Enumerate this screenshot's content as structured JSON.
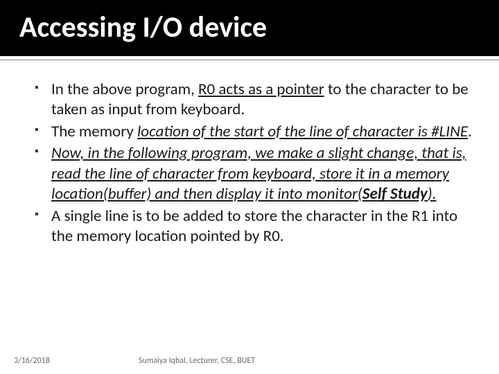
{
  "title": "Accessing I/O device",
  "bullets": {
    "b1a": "In the above program, ",
    "b1b": "R0 acts as a pointer",
    "b1c": " to the character to be taken as input from keyboard.",
    "b2a": "The memory ",
    "b2b": "location of the start of the line of character is #LINE",
    "b2c": ".",
    "b3a": "Now, in the following program, we make a slight change, that is, read the line of character from keyboard, store it in a memory location(buffer) and then display it into monitor(",
    "b3b": "Self Study",
    "b3c": ").",
    "b4": "A single line is to be added to store the character in the R1 into the memory location pointed by R0."
  },
  "footer": {
    "date": "3/16/2018",
    "author": "Sumaiya Iqbal, Lecturer, CSE, BUET"
  }
}
